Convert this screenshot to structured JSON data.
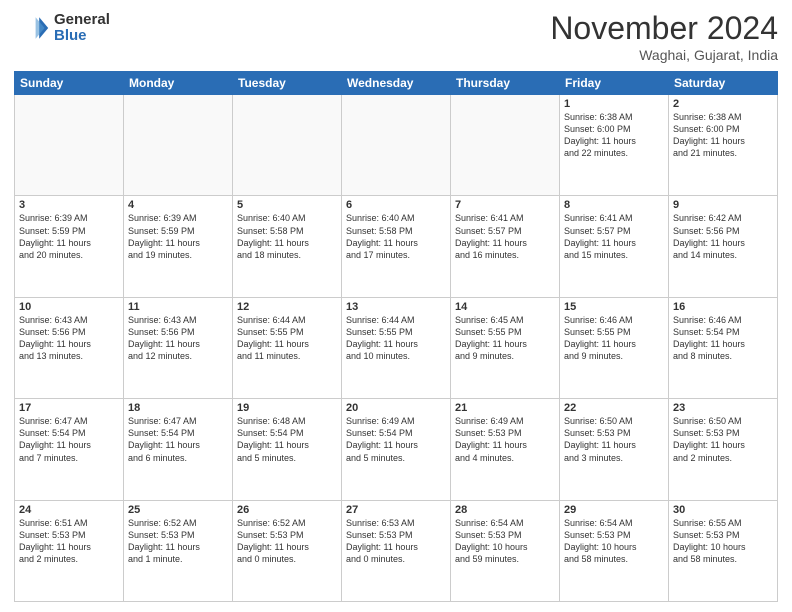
{
  "header": {
    "logo_general": "General",
    "logo_blue": "Blue",
    "month_title": "November 2024",
    "location": "Waghai, Gujarat, India"
  },
  "days_of_week": [
    "Sunday",
    "Monday",
    "Tuesday",
    "Wednesday",
    "Thursday",
    "Friday",
    "Saturday"
  ],
  "weeks": [
    [
      {
        "day": "",
        "info": ""
      },
      {
        "day": "",
        "info": ""
      },
      {
        "day": "",
        "info": ""
      },
      {
        "day": "",
        "info": ""
      },
      {
        "day": "",
        "info": ""
      },
      {
        "day": "1",
        "info": "Sunrise: 6:38 AM\nSunset: 6:00 PM\nDaylight: 11 hours\nand 22 minutes."
      },
      {
        "day": "2",
        "info": "Sunrise: 6:38 AM\nSunset: 6:00 PM\nDaylight: 11 hours\nand 21 minutes."
      }
    ],
    [
      {
        "day": "3",
        "info": "Sunrise: 6:39 AM\nSunset: 5:59 PM\nDaylight: 11 hours\nand 20 minutes."
      },
      {
        "day": "4",
        "info": "Sunrise: 6:39 AM\nSunset: 5:59 PM\nDaylight: 11 hours\nand 19 minutes."
      },
      {
        "day": "5",
        "info": "Sunrise: 6:40 AM\nSunset: 5:58 PM\nDaylight: 11 hours\nand 18 minutes."
      },
      {
        "day": "6",
        "info": "Sunrise: 6:40 AM\nSunset: 5:58 PM\nDaylight: 11 hours\nand 17 minutes."
      },
      {
        "day": "7",
        "info": "Sunrise: 6:41 AM\nSunset: 5:57 PM\nDaylight: 11 hours\nand 16 minutes."
      },
      {
        "day": "8",
        "info": "Sunrise: 6:41 AM\nSunset: 5:57 PM\nDaylight: 11 hours\nand 15 minutes."
      },
      {
        "day": "9",
        "info": "Sunrise: 6:42 AM\nSunset: 5:56 PM\nDaylight: 11 hours\nand 14 minutes."
      }
    ],
    [
      {
        "day": "10",
        "info": "Sunrise: 6:43 AM\nSunset: 5:56 PM\nDaylight: 11 hours\nand 13 minutes."
      },
      {
        "day": "11",
        "info": "Sunrise: 6:43 AM\nSunset: 5:56 PM\nDaylight: 11 hours\nand 12 minutes."
      },
      {
        "day": "12",
        "info": "Sunrise: 6:44 AM\nSunset: 5:55 PM\nDaylight: 11 hours\nand 11 minutes."
      },
      {
        "day": "13",
        "info": "Sunrise: 6:44 AM\nSunset: 5:55 PM\nDaylight: 11 hours\nand 10 minutes."
      },
      {
        "day": "14",
        "info": "Sunrise: 6:45 AM\nSunset: 5:55 PM\nDaylight: 11 hours\nand 9 minutes."
      },
      {
        "day": "15",
        "info": "Sunrise: 6:46 AM\nSunset: 5:55 PM\nDaylight: 11 hours\nand 9 minutes."
      },
      {
        "day": "16",
        "info": "Sunrise: 6:46 AM\nSunset: 5:54 PM\nDaylight: 11 hours\nand 8 minutes."
      }
    ],
    [
      {
        "day": "17",
        "info": "Sunrise: 6:47 AM\nSunset: 5:54 PM\nDaylight: 11 hours\nand 7 minutes."
      },
      {
        "day": "18",
        "info": "Sunrise: 6:47 AM\nSunset: 5:54 PM\nDaylight: 11 hours\nand 6 minutes."
      },
      {
        "day": "19",
        "info": "Sunrise: 6:48 AM\nSunset: 5:54 PM\nDaylight: 11 hours\nand 5 minutes."
      },
      {
        "day": "20",
        "info": "Sunrise: 6:49 AM\nSunset: 5:54 PM\nDaylight: 11 hours\nand 5 minutes."
      },
      {
        "day": "21",
        "info": "Sunrise: 6:49 AM\nSunset: 5:53 PM\nDaylight: 11 hours\nand 4 minutes."
      },
      {
        "day": "22",
        "info": "Sunrise: 6:50 AM\nSunset: 5:53 PM\nDaylight: 11 hours\nand 3 minutes."
      },
      {
        "day": "23",
        "info": "Sunrise: 6:50 AM\nSunset: 5:53 PM\nDaylight: 11 hours\nand 2 minutes."
      }
    ],
    [
      {
        "day": "24",
        "info": "Sunrise: 6:51 AM\nSunset: 5:53 PM\nDaylight: 11 hours\nand 2 minutes."
      },
      {
        "day": "25",
        "info": "Sunrise: 6:52 AM\nSunset: 5:53 PM\nDaylight: 11 hours\nand 1 minute."
      },
      {
        "day": "26",
        "info": "Sunrise: 6:52 AM\nSunset: 5:53 PM\nDaylight: 11 hours\nand 0 minutes."
      },
      {
        "day": "27",
        "info": "Sunrise: 6:53 AM\nSunset: 5:53 PM\nDaylight: 11 hours\nand 0 minutes."
      },
      {
        "day": "28",
        "info": "Sunrise: 6:54 AM\nSunset: 5:53 PM\nDaylight: 10 hours\nand 59 minutes."
      },
      {
        "day": "29",
        "info": "Sunrise: 6:54 AM\nSunset: 5:53 PM\nDaylight: 10 hours\nand 58 minutes."
      },
      {
        "day": "30",
        "info": "Sunrise: 6:55 AM\nSunset: 5:53 PM\nDaylight: 10 hours\nand 58 minutes."
      }
    ]
  ]
}
